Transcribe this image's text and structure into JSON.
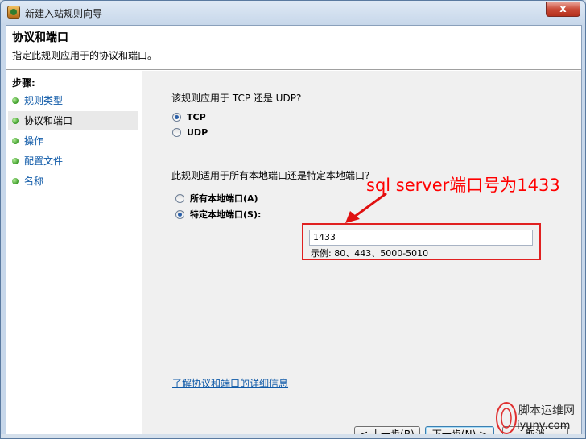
{
  "window": {
    "title": "新建入站规则向导",
    "close_label": "x"
  },
  "header": {
    "title": "协议和端口",
    "description": "指定此规则应用于的协议和端口。"
  },
  "sidebar": {
    "steps_label": "步骤:",
    "items": [
      {
        "label": "规则类型",
        "state": "link"
      },
      {
        "label": "协议和端口",
        "state": "current"
      },
      {
        "label": "操作",
        "state": "link"
      },
      {
        "label": "配置文件",
        "state": "link"
      },
      {
        "label": "名称",
        "state": "link"
      }
    ]
  },
  "protocol": {
    "question": "该规则应用于 TCP 还是 UDP?",
    "options": [
      "TCP",
      "UDP"
    ],
    "selected": "TCP"
  },
  "ports": {
    "question": "此规则适用于所有本地端口还是特定本地端口?",
    "options": [
      "所有本地端口(A)",
      "特定本地端口(S):"
    ],
    "selected": "特定本地端口(S):",
    "input_value": "1433",
    "example": "示例: 80、443、5000-5010"
  },
  "annotation": {
    "text": "sql server端口号为1433",
    "color": "#ff0000"
  },
  "link": {
    "text": "了解协议和端口的详细信息"
  },
  "buttons": {
    "back": "< 上一步(B)",
    "next": "下一步(N) >",
    "cancel": "取消"
  },
  "watermark": {
    "line1": "脚本运维网",
    "line2": "iyunv.com"
  }
}
